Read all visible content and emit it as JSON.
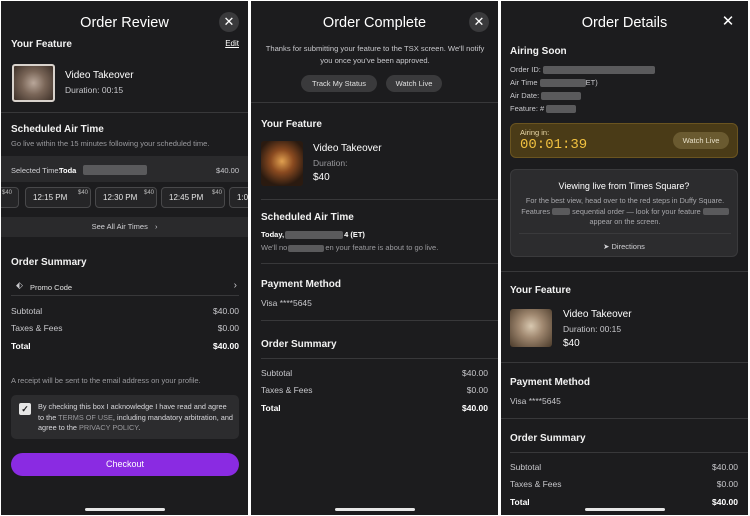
{
  "review": {
    "title": "Order Review",
    "your_feature": "Your Feature",
    "edit": "Edit",
    "feature_name": "Video Takeover",
    "duration": "Duration: 00:15",
    "scheduled_title": "Scheduled Air Time",
    "scheduled_desc": "Go live within the 15 minutes following your scheduled time.",
    "selected_label": "Selected Time:",
    "selected_value": "Toda",
    "selected_price": "$40.00",
    "edge_price_left": "$40",
    "times": [
      {
        "time": "12:15 PM",
        "price": "$40"
      },
      {
        "time": "12:30 PM",
        "price": "$40"
      },
      {
        "time": "12:45 PM",
        "price": "$40"
      },
      {
        "time": "1:0",
        "price": ""
      }
    ],
    "see_all": "See All Air Times",
    "summary_title": "Order Summary",
    "promo": "Promo Code",
    "subtotal_label": "Subtotal",
    "subtotal": "$40.00",
    "taxes_label": "Taxes & Fees",
    "taxes": "$0.00",
    "total_label": "Total",
    "total": "$40.00",
    "receipt_note": "A receipt will be sent to the email address on your profile.",
    "consent_a": "By checking this box I acknowledge I have read and agree to the ",
    "terms": "TERMS OF USE",
    "consent_b": ", including mandatory arbitration, and agree to the ",
    "privacy": "PRIVACY POLICY",
    "consent_c": ".",
    "checkout": "Checkout"
  },
  "complete": {
    "title": "Order Complete",
    "thanks": "Thanks for submitting your feature to the TSX screen. We'll notify you once you've been approved.",
    "track": "Track My Status",
    "watch": "Watch Live",
    "your_feature": "Your Feature",
    "feature_name": "Video Takeover",
    "duration_label": "Duration:",
    "price": "$40",
    "scheduled_title": "Scheduled Air Time",
    "today": "Today,",
    "today_tail": "4 (ET)",
    "notify_a": "We'll no",
    "notify_b": "en your feature is about to go live.",
    "payment_title": "Payment Method",
    "visa": "Visa ****5645",
    "summary_title": "Order Summary",
    "subtotal_label": "Subtotal",
    "subtotal": "$40.00",
    "taxes_label": "Taxes & Fees",
    "taxes": "$0.00",
    "total_label": "Total",
    "total": "$40.00"
  },
  "details": {
    "title": "Order Details",
    "airing_soon": "Airing Soon",
    "order_id": "Order ID:",
    "air_time": "Air Time",
    "air_time_tail": "ET)",
    "air_date": "Air Date:",
    "feature_label": "Feature:",
    "feature_hash": "#",
    "airing_in": "Airing in:",
    "countdown": "00:01:39",
    "watch_live": "Watch Live",
    "viewing_title": "Viewing live from Times Square?",
    "viewing_a": "For the best view, head over to the red steps in Duffy Square. Features",
    "viewing_b": "sequential order — look for your feature",
    "viewing_c": "appear on the screen.",
    "directions": "Directions",
    "your_feature": "Your Feature",
    "feature_name": "Video Takeover",
    "duration": "Duration: 00:15",
    "price": "$40",
    "payment_title": "Payment Method",
    "visa": "Visa ****5645",
    "summary_title": "Order Summary",
    "subtotal_label": "Subtotal",
    "subtotal": "$40.00",
    "taxes_label": "Taxes & Fees",
    "taxes": "$0.00",
    "total_label": "Total",
    "total": "$40.00"
  },
  "colors": {
    "background": "#1c1c1e",
    "accent_purple": "#8a2be2",
    "countdown_gold": "#f0c040"
  }
}
